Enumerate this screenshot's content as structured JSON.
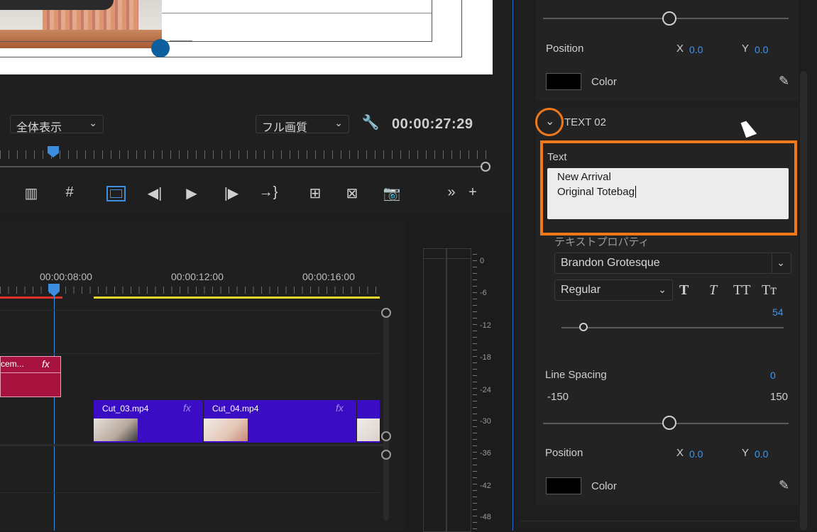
{
  "monitor": {
    "zoom_select": "全体表示",
    "quality_select": "フル画質",
    "timecode": "00:00:27:29"
  },
  "timeline": {
    "ruler_labels": [
      "00:00:08:00",
      "00:00:12:00",
      "00:00:16:00"
    ],
    "clip_partial": "cem...",
    "clip_fx": "fx",
    "clips": [
      {
        "name": "Cut_03.mp4",
        "fx": "fx"
      },
      {
        "name": "Cut_04.mp4",
        "fx": "fx"
      }
    ]
  },
  "meter": {
    "db_labels": [
      "0",
      "-6",
      "-12",
      "-18",
      "-24",
      "-30",
      "-36",
      "-42",
      "-48"
    ]
  },
  "panel": {
    "top_section": {
      "position_label": "Position",
      "x_label": "X",
      "x_value": "0.0",
      "y_label": "Y",
      "y_value": "0.0",
      "color_label": "Color",
      "color_value": "#000000"
    },
    "text02": {
      "header": "TEXT 02",
      "text_label": "Text",
      "text_line1": "New Arrival",
      "text_line2": "Original Totebag",
      "props_label": "テキストプロパティ",
      "font_family": "Brandon Grotesque",
      "font_style": "Regular",
      "style_buttons": [
        "T",
        "T",
        "TT",
        "Tт"
      ],
      "font_size": "54",
      "font_size_fraction": 0.1,
      "line_spacing_label": "Line Spacing",
      "line_spacing_value": "0",
      "line_min": "-150",
      "line_max": "150",
      "position_label": "Position",
      "x_label": "X",
      "x_value": "0.0",
      "y_label": "Y",
      "y_value": "0.0",
      "color_label": "Color",
      "color_value": "#000000"
    }
  }
}
